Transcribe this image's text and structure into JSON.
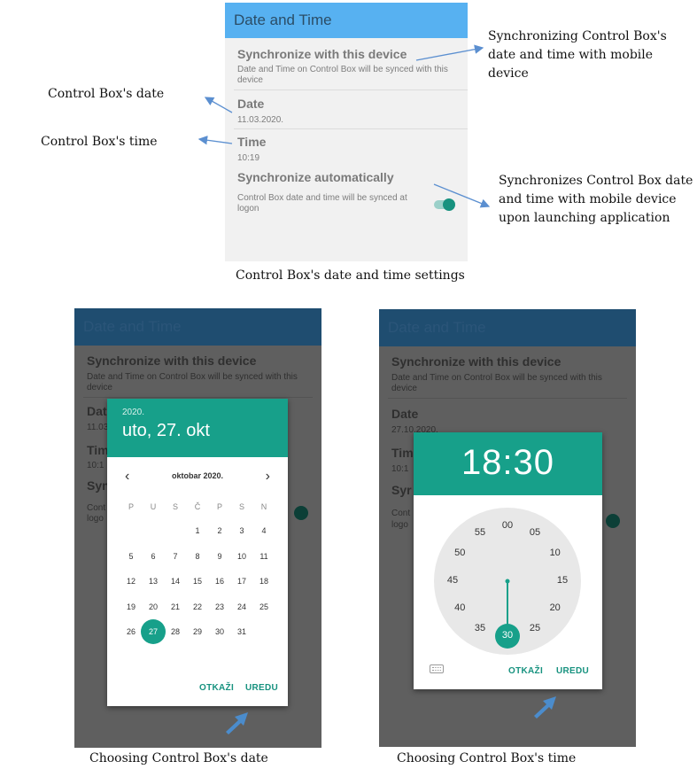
{
  "settings": {
    "app_title": "Date and Time",
    "sync_device_title": "Synchronize with this device",
    "sync_device_desc": "Date and Time on Control Box will be synced with this device",
    "date_title": "Date",
    "date_value": "11.03.2020.",
    "time_title": "Time",
    "time_value": "10:19",
    "sync_auto_title": "Synchronize automatically",
    "sync_auto_desc": "Control Box date and time will be synced at logon",
    "sync_auto_enabled": true
  },
  "annotations": {
    "sync_device": "Synchronizing Control Box's date and time with mobile device",
    "date": "Control Box's date",
    "time": "Control Box's time",
    "sync_auto": "Synchronizes Control Box date and time with mobile device upon launching application"
  },
  "captions": {
    "settings": "Control Box's date and time settings",
    "date": "Choosing Control Box's date",
    "time": "Choosing Control Box's time"
  },
  "date_screen": {
    "title": "Date and Time",
    "sync_title": "Synchronize with this device",
    "sync_desc": "Date and Time on Control Box will be synced with this device",
    "date_partial": "Date",
    "date_value_partial": "11.03",
    "time_partial": "Time",
    "time_value_partial": "10:1",
    "auto_partial": "Syn",
    "auto_desc_partial_1": "Cont",
    "auto_desc_partial_2": "logo"
  },
  "date_picker": {
    "year": "2020.",
    "selected_label": "uto, 27. okt",
    "month_label": "oktobar 2020.",
    "weekdays": [
      "P",
      "U",
      "S",
      "Č",
      "P",
      "S",
      "N"
    ],
    "weeks": [
      [
        "",
        "",
        "",
        "1",
        "2",
        "3",
        "4"
      ],
      [
        "5",
        "6",
        "7",
        "8",
        "9",
        "10",
        "11"
      ],
      [
        "12",
        "13",
        "14",
        "15",
        "16",
        "17",
        "18"
      ],
      [
        "19",
        "20",
        "21",
        "22",
        "23",
        "24",
        "25"
      ],
      [
        "26",
        "27",
        "28",
        "29",
        "30",
        "31",
        ""
      ]
    ],
    "selected_day": "27",
    "cancel_label": "OTKAŽI",
    "ok_label": "UREDU"
  },
  "time_screen": {
    "title": "Date and Time",
    "sync_title": "Synchronize with this device",
    "sync_desc": "Date and Time on Control Box will be synced with this device",
    "date_title": "Date",
    "date_value_partial": "27.10.2020.",
    "time_partial": "Tim",
    "time_value_partial": "10:1",
    "auto_partial": "Syr",
    "auto_desc_partial_1": "Cont",
    "auto_desc_partial_2": "logo"
  },
  "time_picker": {
    "time_display": "18:30",
    "minutes": [
      "00",
      "05",
      "10",
      "15",
      "20",
      "25",
      "30",
      "35",
      "40",
      "45",
      "50",
      "55"
    ],
    "selected_minute": "30",
    "keyboard_icon": "keyboard-icon",
    "cancel_label": "OTKAŽI",
    "ok_label": "UREDU"
  },
  "colors": {
    "app_bar": "#57b1f1",
    "accent": "#17a08a",
    "annotation_arrow": "#5b8fd0"
  }
}
